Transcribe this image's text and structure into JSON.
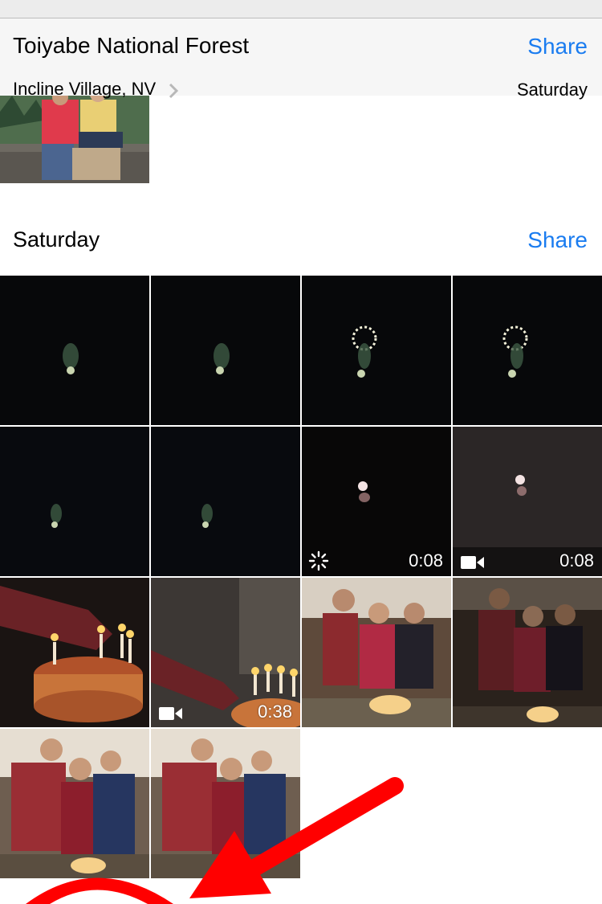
{
  "header": {
    "title": "Toiyabe National Forest",
    "subtitle": "Incline Village, NV",
    "share_label": "Share",
    "date": "Saturday"
  },
  "section": {
    "title": "Saturday",
    "share_label": "Share"
  },
  "colors": {
    "accent": "#1a7cf0",
    "annotation": "#ff0000"
  },
  "tiles": [
    {
      "kind": "night-firework",
      "video": false
    },
    {
      "kind": "night-firework",
      "video": false
    },
    {
      "kind": "night-firework",
      "video": false
    },
    {
      "kind": "night-firework",
      "video": false
    },
    {
      "kind": "night-firework",
      "video": false
    },
    {
      "kind": "night-firework",
      "video": false
    },
    {
      "kind": "night-firework",
      "video": true,
      "duration": "0:08",
      "badge": "loading-spinner-icon"
    },
    {
      "kind": "night-firework",
      "video": true,
      "duration": "0:08",
      "badge": "video-camera-icon"
    },
    {
      "kind": "birthday-cake",
      "video": false
    },
    {
      "kind": "birthday-cake",
      "video": true,
      "duration": "0:38",
      "badge": "video-camera-icon"
    },
    {
      "kind": "family-group",
      "video": false
    },
    {
      "kind": "family-group",
      "video": false
    },
    {
      "kind": "family-group",
      "video": false
    },
    {
      "kind": "family-group",
      "video": false
    }
  ]
}
